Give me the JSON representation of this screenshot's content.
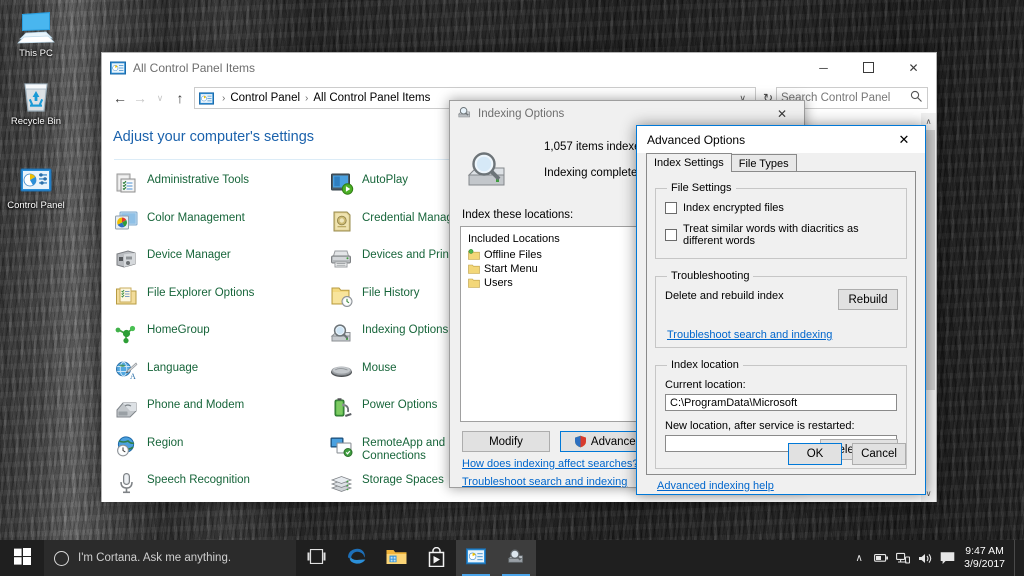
{
  "desktop": {
    "icons": [
      {
        "name": "This PC",
        "icon": "monitor-icon"
      },
      {
        "name": "Recycle Bin",
        "icon": "recycle-bin-icon"
      },
      {
        "name": "Control Panel",
        "icon": "control-panel-icon"
      }
    ]
  },
  "control_panel": {
    "title": "All Control Panel Items",
    "window_icon": "control-panel-icon",
    "caption": {
      "minimize": "─",
      "maximize": "☐",
      "close": "✕"
    },
    "nav": {
      "back": "←",
      "forward": "→",
      "recent": "∨",
      "up": "↑",
      "refresh": "↻",
      "breadcrumb_icon": "control-panel-icon",
      "breadcrumb": [
        "Control Panel",
        "All Control Panel Items"
      ],
      "breadcrumb_separator": "›",
      "dropdown_caret": "∨"
    },
    "search": {
      "placeholder": "Search Control Panel",
      "icon": "search-icon"
    },
    "heading": "Adjust your computer's settings",
    "items": [
      {
        "label": "Administrative Tools",
        "icon": "administrative-tools-icon"
      },
      {
        "label": "AutoPlay",
        "icon": "autoplay-icon"
      },
      {
        "label": "Color Management",
        "icon": "color-management-icon"
      },
      {
        "label": "Credential Manager",
        "icon": "credential-manager-icon"
      },
      {
        "label": "Device Manager",
        "icon": "device-manager-icon"
      },
      {
        "label": "Devices and Printers",
        "icon": "devices-and-printers-icon"
      },
      {
        "label": "File Explorer Options",
        "icon": "file-explorer-options-icon"
      },
      {
        "label": "File History",
        "icon": "file-history-icon"
      },
      {
        "label": "HomeGroup",
        "icon": "homegroup-icon"
      },
      {
        "label": "Indexing Options",
        "icon": "indexing-options-icon"
      },
      {
        "label": "Language",
        "icon": "language-icon"
      },
      {
        "label": "Mouse",
        "icon": "mouse-icon"
      },
      {
        "label": "Phone and Modem",
        "icon": "phone-and-modem-icon"
      },
      {
        "label": "Power Options",
        "icon": "power-options-icon"
      },
      {
        "label": "Region",
        "icon": "region-icon"
      },
      {
        "label": "RemoteApp and Desktop Connections",
        "icon": "remoteapp-icon"
      },
      {
        "label": "Speech Recognition",
        "icon": "speech-recognition-icon"
      },
      {
        "label": "Storage Spaces",
        "icon": "storage-spaces-icon"
      }
    ],
    "scrollbar": {
      "up": "∧",
      "down": "∨"
    }
  },
  "indexing_options": {
    "title": "Indexing Options",
    "window_icon": "indexing-options-icon",
    "close": "✕",
    "items_indexed": "1,057 items indexed",
    "status": "Indexing complete.",
    "locations_label": "Index these locations:",
    "list_header": "Included Locations",
    "locations": [
      {
        "label": "Offline Files",
        "icon": "folder-offline-icon"
      },
      {
        "label": "Start Menu",
        "icon": "folder-icon"
      },
      {
        "label": "Users",
        "icon": "folder-icon"
      }
    ],
    "buttons": {
      "modify": "Modify",
      "advanced": "Advanced",
      "advanced_icon": "uac-shield-icon"
    },
    "links": [
      "How does indexing affect searches?",
      "Troubleshoot search and indexing"
    ]
  },
  "advanced_options": {
    "title": "Advanced Options",
    "close": "✕",
    "tabs": [
      {
        "label": "Index Settings",
        "active": true
      },
      {
        "label": "File Types",
        "active": false
      }
    ],
    "file_settings": {
      "legend": "File Settings",
      "checkboxes": [
        {
          "label": "Index encrypted files",
          "checked": false
        },
        {
          "label": "Treat similar words with diacritics as different words",
          "checked": false
        }
      ]
    },
    "troubleshooting": {
      "legend": "Troubleshooting",
      "text": "Delete and rebuild index",
      "rebuild_button": "Rebuild",
      "link": "Troubleshoot search and indexing"
    },
    "index_location": {
      "legend": "Index location",
      "current_label": "Current location:",
      "current_value": "C:\\ProgramData\\Microsoft",
      "new_label": "New location, after service is restarted:",
      "new_value": "",
      "select_button": "Select new"
    },
    "help_link": "Advanced indexing help",
    "ok": "OK",
    "cancel": "Cancel"
  },
  "taskbar": {
    "start_icon": "windows-start-icon",
    "cortana_placeholder": "I'm Cortana. Ask me anything.",
    "cortana_icon": "cortana-circle-icon",
    "buttons": [
      {
        "name": "task-view-icon",
        "running": false
      },
      {
        "name": "edge-icon",
        "running": false
      },
      {
        "name": "file-explorer-icon",
        "running": false
      },
      {
        "name": "store-icon",
        "running": false
      },
      {
        "name": "control-panel-icon",
        "running": true
      },
      {
        "name": "indexing-options-icon",
        "running": true
      }
    ],
    "tray": [
      {
        "name": "show-hidden-icons-chevron",
        "glyph": "∧"
      },
      {
        "name": "battery-icon"
      },
      {
        "name": "network-icon"
      },
      {
        "name": "volume-icon"
      },
      {
        "name": "action-center-icon"
      }
    ],
    "clock": {
      "time": "9:47 AM",
      "date": "3/9/2017"
    }
  },
  "colors": {
    "accent": "#0078d7",
    "link": "#0066cc",
    "cp_item_text": "#17653a",
    "cp_heading": "#1b62ac",
    "taskbar": "#1f1f1f"
  }
}
